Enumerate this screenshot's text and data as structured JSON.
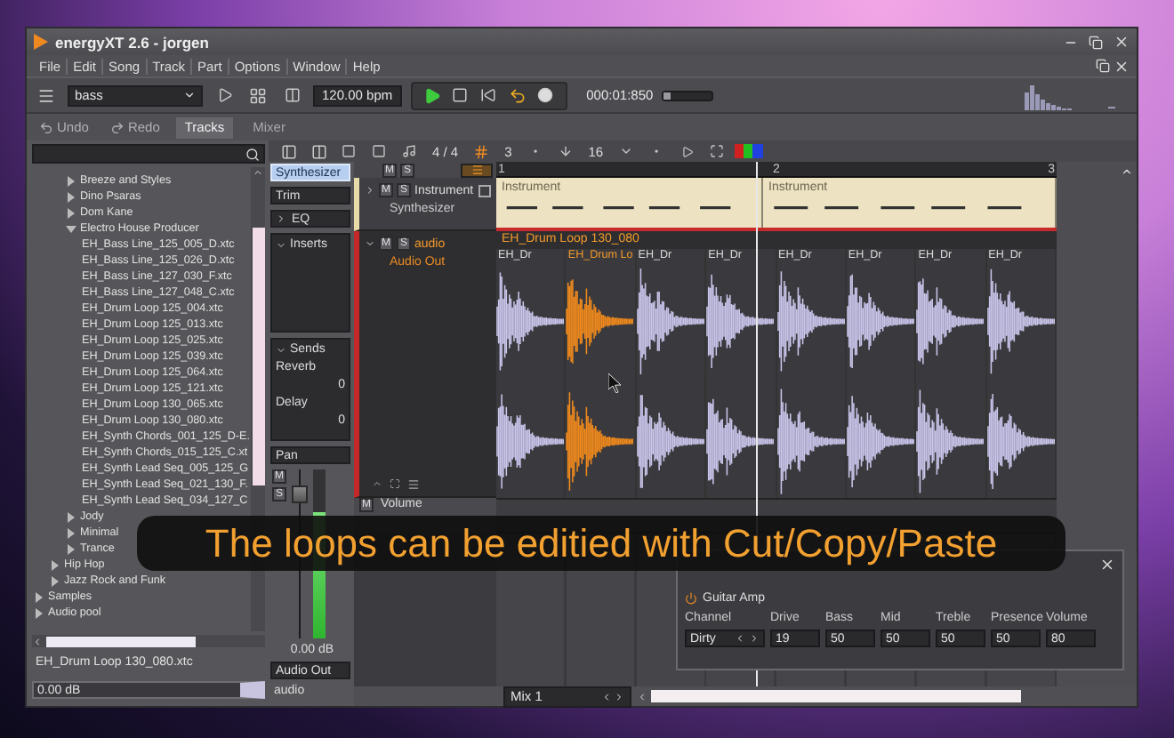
{
  "window": {
    "title": "energyXT 2.6 - jorgen"
  },
  "menu": [
    "File",
    "Edit",
    "Song",
    "Track",
    "Part",
    "Options",
    "Window",
    "Help"
  ],
  "transport": {
    "song": "bass",
    "tempo": "120.00 bpm",
    "time": "000:01:850",
    "volume": {
      "level": 0.15
    }
  },
  "edit_bar": {
    "undo": "Undo",
    "redo": "Redo",
    "tabs": [
      {
        "label": "Tracks",
        "selected": true
      },
      {
        "label": "Mixer",
        "selected": false
      }
    ]
  },
  "browser": {
    "tree": [
      {
        "children": [
          {
            "children": [
              {
                "kind": "folder",
                "label": "Breeze and Styles",
                "expanded": false
              },
              {
                "kind": "folder",
                "label": "Dino Psaras",
                "expanded": false
              },
              {
                "kind": "folder",
                "label": "Dom Kane",
                "expanded": false
              },
              {
                "kind": "folder",
                "label": "Electro House Producer",
                "expanded": true,
                "children": [
                  {
                    "kind": "file",
                    "label": "EH_Bass Line_125_005_D.xtc"
                  },
                  {
                    "kind": "file",
                    "label": "EH_Bass Line_125_026_D.xtc"
                  },
                  {
                    "kind": "file",
                    "label": "EH_Bass Line_127_030_F.xtc"
                  },
                  {
                    "kind": "file",
                    "label": "EH_Bass Line_127_048_C.xtc"
                  },
                  {
                    "kind": "file",
                    "label": "EH_Drum Loop 125_004.xtc"
                  },
                  {
                    "kind": "file",
                    "label": "EH_Drum Loop 125_013.xtc"
                  },
                  {
                    "kind": "file",
                    "label": "EH_Drum Loop 125_025.xtc"
                  },
                  {
                    "kind": "file",
                    "label": "EH_Drum Loop 125_039.xtc"
                  },
                  {
                    "kind": "file",
                    "label": "EH_Drum Loop 125_064.xtc"
                  },
                  {
                    "kind": "file",
                    "label": "EH_Drum Loop 125_121.xtc"
                  },
                  {
                    "kind": "file",
                    "label": "EH_Drum Loop 130_065.xtc"
                  },
                  {
                    "kind": "file",
                    "label": "EH_Drum Loop 130_080.xtc"
                  },
                  {
                    "kind": "file",
                    "label": "EH_Synth Chords_001_125_D-E."
                  },
                  {
                    "kind": "file",
                    "label": "EH_Synth Chords_015_125_C.xt"
                  },
                  {
                    "kind": "file",
                    "label": "EH_Synth Lead Seq_005_125_G"
                  },
                  {
                    "kind": "file",
                    "label": "EH_Synth Lead Seq_021_130_F."
                  },
                  {
                    "kind": "file",
                    "label": "EH_Synth Lead Seq_034_127_C"
                  }
                ]
              },
              {
                "kind": "folder",
                "label": "Jody",
                "expanded": false
              },
              {
                "kind": "folder",
                "label": "Minimal",
                "expanded": false
              },
              {
                "kind": "folder",
                "label": "Trance",
                "expanded": false
              }
            ]
          },
          {
            "kind": "folder",
            "label": "Hip Hop",
            "expanded": false
          },
          {
            "kind": "folder",
            "label": "Jazz Rock and Funk",
            "expanded": false
          }
        ]
      },
      {
        "kind": "folder",
        "label": "Samples",
        "expanded": false
      },
      {
        "kind": "folder",
        "label": "Audio pool",
        "expanded": false
      }
    ],
    "file": "EH_Drum Loop 130_080.xtc",
    "gain": "0.00 dB"
  },
  "toolbar": {
    "meter": "4 / 4",
    "snap": "3",
    "quantize": "16"
  },
  "channel": {
    "name": "Synthesizer",
    "trim": "Trim",
    "eq": "EQ",
    "inserts": "Inserts",
    "sends_label": "Sends",
    "sends": [
      {
        "name": "Reverb",
        "value": "0"
      },
      {
        "name": "Delay",
        "value": "0"
      }
    ],
    "pan": "Pan",
    "mute": "M",
    "solo": "S",
    "fader": {
      "level": 0.9
    },
    "meter": {
      "level": 0.75
    },
    "gain": "0.00 dB",
    "output": "Audio Out",
    "track": "audio"
  },
  "track_bar": {
    "mute": "M",
    "solo": "S"
  },
  "tracks": [
    {
      "kind": "instrument",
      "name": "Instrument",
      "device": "Synthesizer",
      "mute": "M",
      "solo": "S",
      "checked": false
    },
    {
      "kind": "audio",
      "name": "audio",
      "device": "Audio Out",
      "mute": "M",
      "solo": "S"
    }
  ],
  "automation": {
    "mute": "M",
    "name": "Volume"
  },
  "ruler": [
    "1",
    "2",
    "3"
  ],
  "instrument_clips": [
    {
      "label": "Instrument"
    },
    {
      "label": "Instrument"
    }
  ],
  "audio_clip": {
    "name": "EH_Drum Loop 130_080",
    "slices": [
      {
        "label": "EH_Dr",
        "selected": false
      },
      {
        "label": "EH_Drum Lo",
        "selected": true
      },
      {
        "label": "EH_Dr",
        "selected": false
      },
      {
        "label": "EH_Dr",
        "selected": false
      },
      {
        "label": "EH_Dr",
        "selected": false
      },
      {
        "label": "EH_Dr",
        "selected": false
      },
      {
        "label": "EH_Dr",
        "selected": false
      },
      {
        "label": "EH_Dr",
        "selected": false
      }
    ]
  },
  "mixer_select": "Mix 1",
  "plugin": {
    "title": "Guitar Amp",
    "params": [
      {
        "kind": "choice",
        "name": "Channel",
        "value": "Dirty"
      },
      {
        "kind": "number",
        "name": "Drive",
        "value": "19"
      },
      {
        "kind": "number",
        "name": "Bass",
        "value": "50"
      },
      {
        "kind": "number",
        "name": "Mid",
        "value": "50"
      },
      {
        "kind": "number",
        "name": "Treble",
        "value": "50"
      },
      {
        "kind": "number",
        "name": "Presence",
        "value": "50"
      },
      {
        "kind": "number",
        "name": "Volume",
        "value": "80"
      }
    ]
  },
  "caption": "The loops can be editied with Cut/Copy/Paste"
}
